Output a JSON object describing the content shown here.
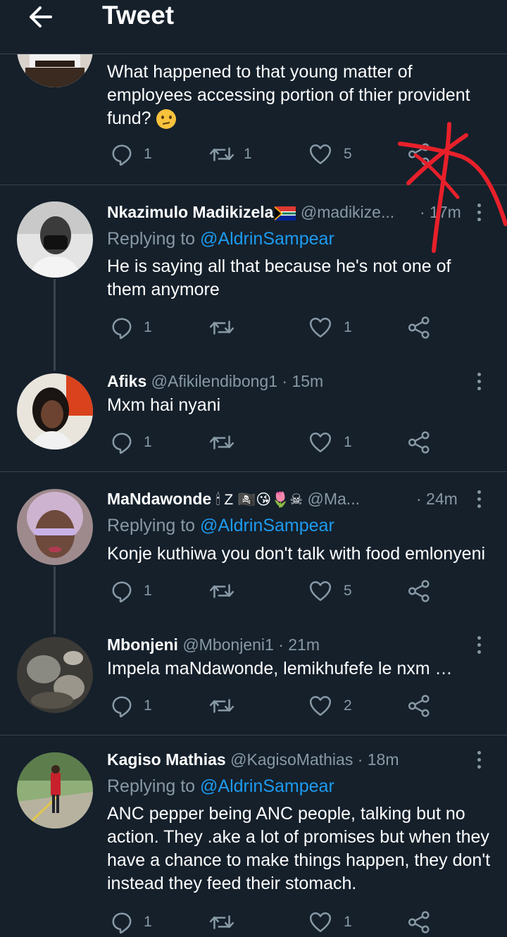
{
  "header": {
    "title": "Tweet"
  },
  "main_tweet": {
    "text": "What happened to that young matter of employees accessing portion of thier provident fund?",
    "replies": "1",
    "retweets": "1",
    "likes": "5"
  },
  "replies": [
    {
      "name": "Nkazimulo Madikizela",
      "handle": "@madikize...",
      "time": "· 17m",
      "replying_label": "Replying to",
      "replying_to": "@AldrinSampear",
      "text": "He is saying all that because he's not one of them anymore",
      "replies": "1",
      "retweets": "",
      "likes": "1"
    },
    {
      "name": "Afiks",
      "handle": "@Afikilendibong1",
      "time": "· 15m",
      "text": "Mxm hai nyani",
      "replies": "1",
      "retweets": "",
      "likes": "1"
    },
    {
      "name": "MaNdawonde",
      "name_emojis": "🕯 Z 🏴‍☠️😘🌷☠",
      "handle": "@Ma...",
      "time": "· 24m",
      "replying_label": "Replying to",
      "replying_to": "@AldrinSampear",
      "text": "Konje kuthiwa you don't talk with food emlonyeni",
      "replies": "1",
      "retweets": "",
      "likes": "5"
    },
    {
      "name": "Mbonjeni",
      "handle": "@Mbonjeni1",
      "time": "· 21m",
      "text": "Impela maNdawonde, lemikhufefe le nxm …",
      "replies": "1",
      "retweets": "",
      "likes": "2"
    },
    {
      "name": "Kagiso Mathias",
      "handle": "@KagisoMathias",
      "time": "· 18m",
      "replying_label": "Replying to",
      "replying_to": "@AldrinSampear",
      "text": "ANC pepper being ANC people,  talking but no action. They .ake a lot of promises but when they have a chance to make things happen, they don't instead they feed their stomach.",
      "replies": "1",
      "retweets": "",
      "likes": "1"
    }
  ],
  "icons": {
    "back": "arrow-left-icon",
    "reply": "reply-icon",
    "retweet": "retweet-icon",
    "like": "heart-icon",
    "share": "share-icon",
    "more": "more-vertical-icon"
  },
  "colors": {
    "background": "#15202b",
    "divider": "#38444d",
    "secondary_text": "#8899a6",
    "link": "#1d9bf0",
    "annotation": "#e8202a"
  }
}
